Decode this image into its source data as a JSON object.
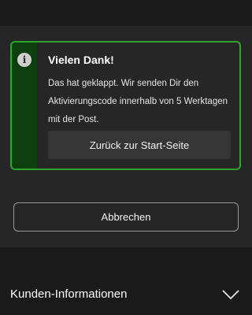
{
  "notice": {
    "title": "Vielen Dank!",
    "body": "Das hat geklappt. Wir senden Dir den Aktivierungscode innerhalb von 5 Werktagen mit der Post.",
    "home_button_label": "Zurück zur Start-Seite",
    "accent_color": "#2ea52e",
    "icon": "info-icon"
  },
  "actions": {
    "cancel_label": "Abbrechen"
  },
  "footer": {
    "label": "Kunden-Informationen",
    "icon": "chevron-down-icon"
  }
}
